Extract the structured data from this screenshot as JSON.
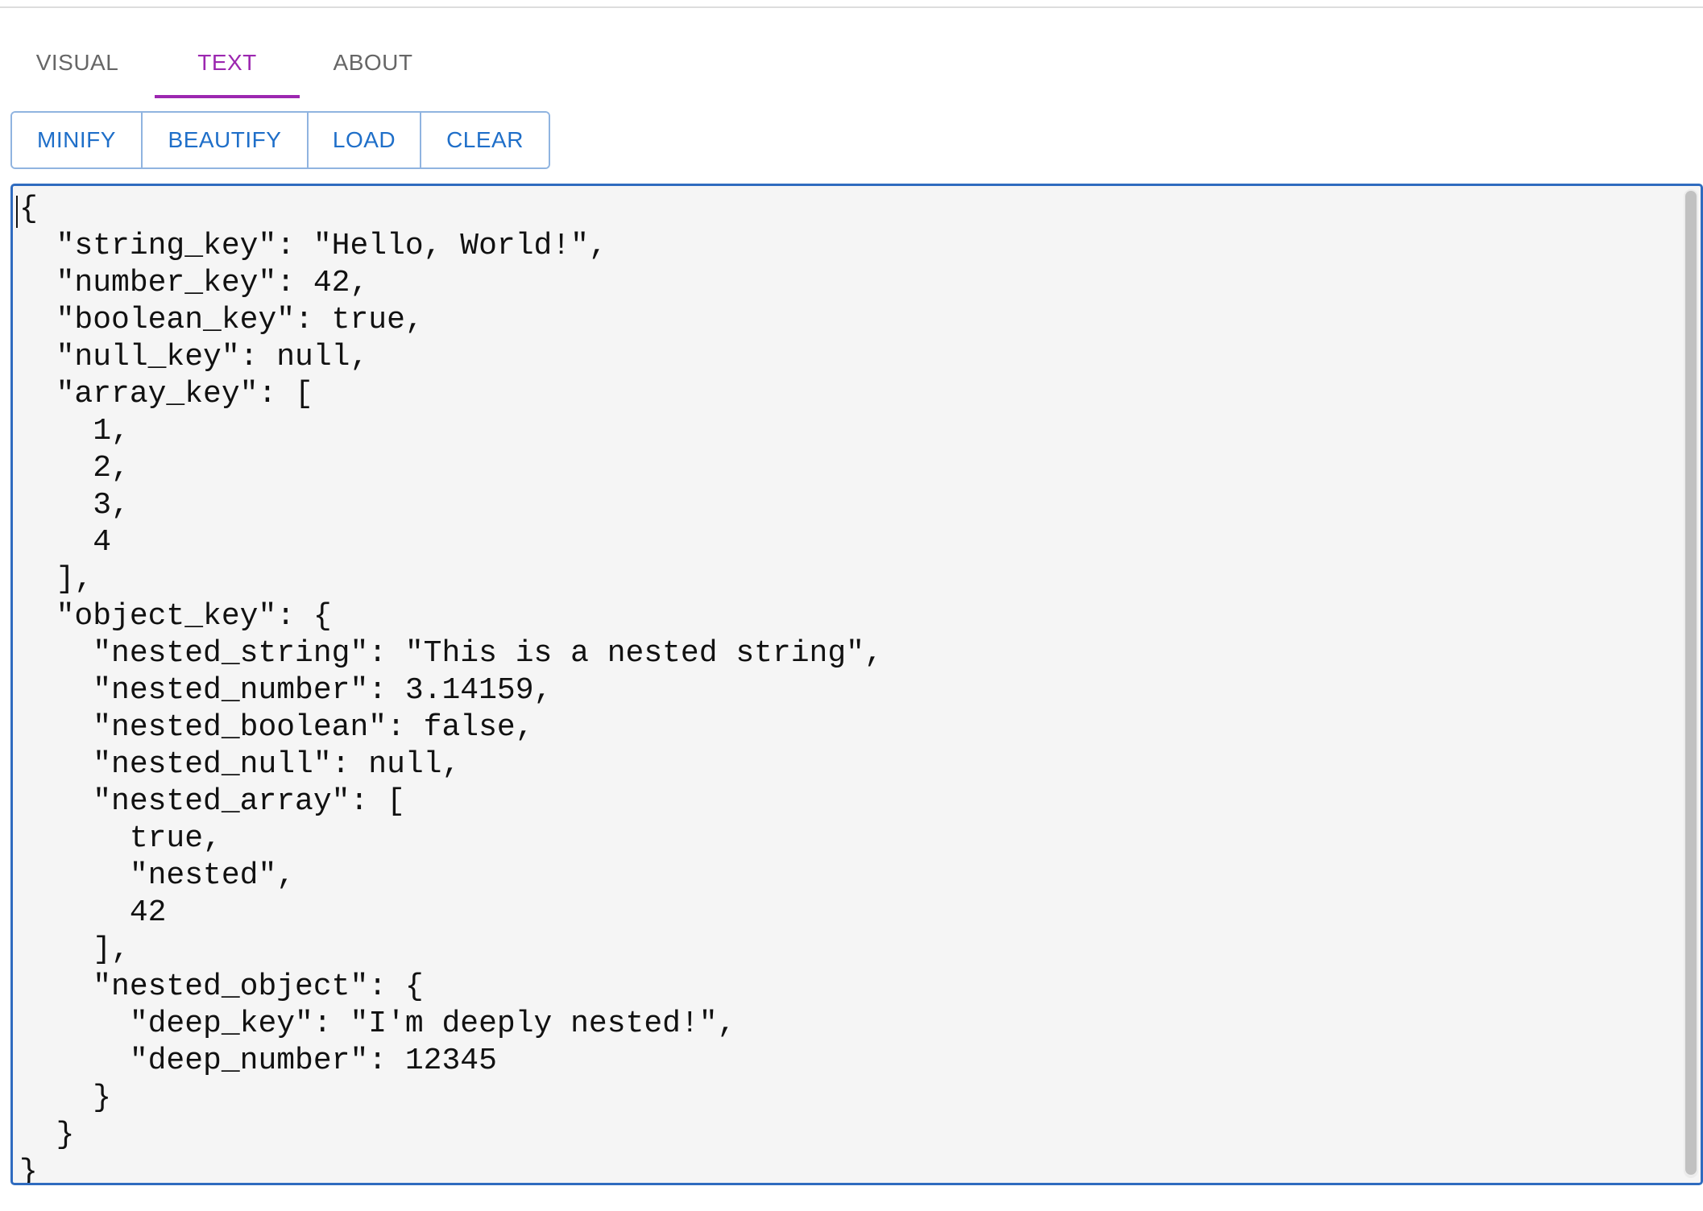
{
  "tabs": [
    {
      "label": "VISUAL",
      "active": false
    },
    {
      "label": "TEXT",
      "active": true
    },
    {
      "label": "ABOUT",
      "active": false
    }
  ],
  "toolbar": {
    "minify_label": "MINIFY",
    "beautify_label": "BEAUTIFY",
    "load_label": "LOAD",
    "clear_label": "CLEAR"
  },
  "editor": {
    "content": "{\n  \"string_key\": \"Hello, World!\",\n  \"number_key\": 42,\n  \"boolean_key\": true,\n  \"null_key\": null,\n  \"array_key\": [\n    1,\n    2,\n    3,\n    4\n  ],\n  \"object_key\": {\n    \"nested_string\": \"This is a nested string\",\n    \"nested_number\": 3.14159,\n    \"nested_boolean\": false,\n    \"nested_null\": null,\n    \"nested_array\": [\n      true,\n      \"nested\",\n      42\n    ],\n    \"nested_object\": {\n      \"deep_key\": \"I'm deeply nested!\",\n      \"deep_number\": 12345\n    }\n  }\n}"
  },
  "colors": {
    "active_tab": "#9c27b0",
    "button_text": "#1f6fc9",
    "editor_border": "#2f6bbf",
    "editor_bg": "#f5f5f5"
  }
}
